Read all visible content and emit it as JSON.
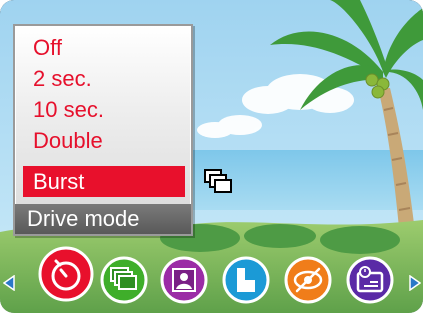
{
  "menu": {
    "title": "Drive mode",
    "items": [
      {
        "label": "Off",
        "selected": false
      },
      {
        "label": "2 sec.",
        "selected": false
      },
      {
        "label": "10 sec.",
        "selected": false
      },
      {
        "label": "Double",
        "selected": false
      },
      {
        "label": "Burst",
        "selected": true
      }
    ]
  },
  "indicator": {
    "icon": "burst-mode-icon"
  },
  "icon_bar": {
    "left_arrow": "left-arrow-icon",
    "right_arrow": "right-arrow-icon",
    "icons": [
      {
        "name": "self-timer-icon",
        "color": "#e8102c",
        "selected": true
      },
      {
        "name": "drive-mode-icon",
        "color": "#3fae2a",
        "selected": false
      },
      {
        "name": "portrait-mode-icon",
        "color": "#9b2ca6",
        "selected": false
      },
      {
        "name": "image-size-icon",
        "color": "#1b9ad6",
        "selected": false
      },
      {
        "name": "red-eye-icon",
        "color": "#f07d1a",
        "selected": false
      },
      {
        "name": "info-display-icon",
        "color": "#5a2aa6",
        "selected": false
      }
    ]
  },
  "colors": {
    "menu_text": "#e6102c",
    "selected_bg": "#e8102c",
    "title_bg": "#666666",
    "arrow": "#2a78c8"
  }
}
